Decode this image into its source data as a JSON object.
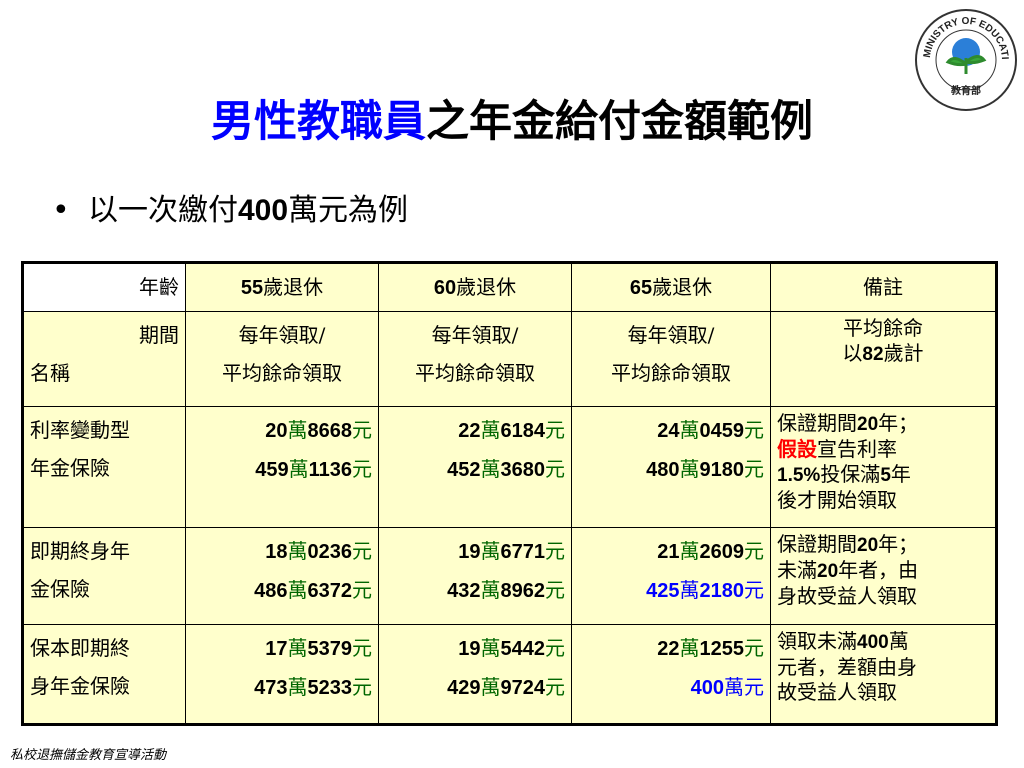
{
  "title": {
    "highlight": "男性教職員",
    "rest": "之年金給付金額範例"
  },
  "bullet": {
    "text_a": "以一次繳付",
    "number": "400",
    "text_b": "萬元為例"
  },
  "logo": {
    "text": "MINISTRY OF EDUCATION",
    "sub": "教育部"
  },
  "table": {
    "header": {
      "col0": "年齡",
      "col1_num": "55",
      "col1_txt": "歲退休",
      "col2_num": "60",
      "col2_txt": "歲退休",
      "col3_num": "65",
      "col3_txt": "歲退休",
      "col4": "備註"
    },
    "row2": {
      "period": "期間",
      "name": "名稱",
      "mode_line1": "每年領取/",
      "mode_line2": "平均餘命領取",
      "note_line1": "平均餘命",
      "note_pre": "以",
      "note_num": "82",
      "note_post": "歲計"
    },
    "rows": [
      {
        "name1": "利率變動型",
        "name2": "年金保險",
        "a": [
          [
            "20",
            "8668"
          ],
          [
            "22",
            "6184"
          ],
          [
            "24",
            "0459"
          ]
        ],
        "b": [
          [
            "459",
            "1136"
          ],
          [
            "452",
            "3680"
          ],
          [
            "480",
            "9180"
          ]
        ],
        "note": {
          "l1_pre": "保證期間",
          "l1_num": "20",
          "l1_post": "年；",
          "l2_red": "假設",
          "l2_post": "宣告利率",
          "l3_num": "1.5%",
          "l3_mid": "投保滿",
          "l3_num2": "5",
          "l3_post": "年",
          "l4": "後才開始領取"
        }
      },
      {
        "name1": "即期終身年",
        "name2": "金保險",
        "a": [
          [
            "18",
            "0236"
          ],
          [
            "19",
            "6771"
          ],
          [
            "21",
            "2609"
          ]
        ],
        "b": [
          [
            "486",
            "6372"
          ],
          [
            "432",
            "8962"
          ],
          [
            "425",
            "2180"
          ]
        ],
        "note": {
          "l1_pre": "保證期間",
          "l1_num": "20",
          "l1_post": "年；",
          "l2_pre": "未滿",
          "l2_num": "20",
          "l2_post": "年者，由",
          "l3": "身故受益人領取"
        }
      },
      {
        "name1": "保本即期終",
        "name2": "身年金保險",
        "a": [
          [
            "17",
            "5379"
          ],
          [
            "19",
            "5442"
          ],
          [
            "22",
            "1255"
          ]
        ],
        "b": [
          [
            "473",
            "5233"
          ],
          [
            "429",
            "9724"
          ]
        ],
        "b_last": {
          "num": "400",
          "txt": "萬元"
        },
        "note": {
          "l1_pre": "領取未滿",
          "l1_num": "400",
          "l1_post": "萬",
          "l2": "元者，差額由身",
          "l3": "故受益人領取"
        }
      }
    ],
    "units": {
      "wan": "萬",
      "yuan": "元"
    }
  },
  "footer": "私校退撫儲金教育宣導活動",
  "colors": {
    "accent_blue": "#0000ff",
    "amount_green": "#006600",
    "highlight_red": "#ff0000",
    "table_bg": "#ffffcc"
  }
}
